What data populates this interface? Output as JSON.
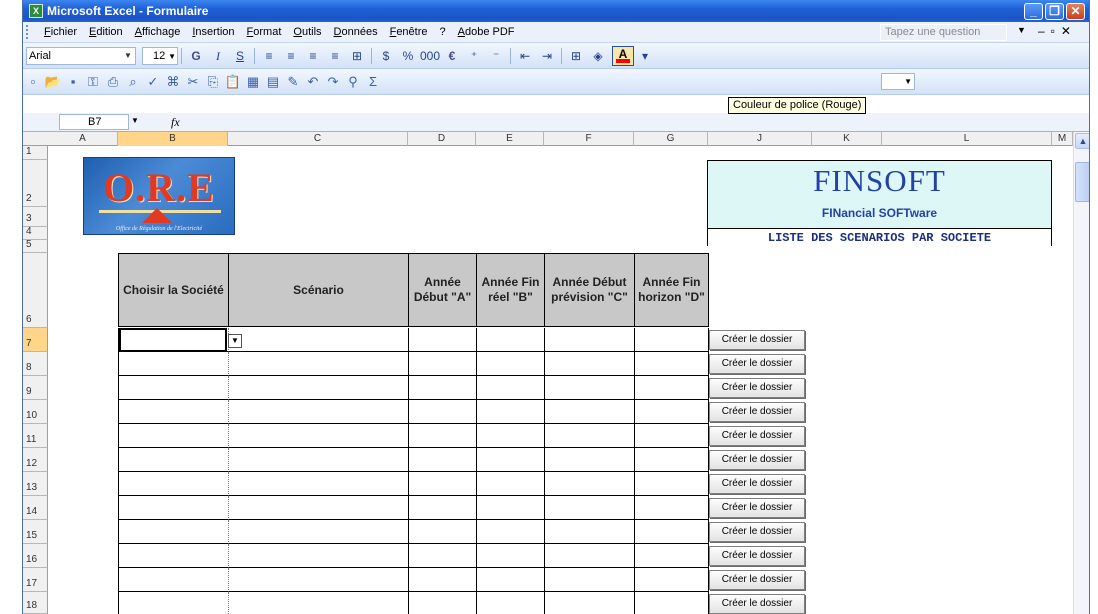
{
  "window": {
    "title": "Microsoft Excel - Formulaire",
    "app_icon": "excel-icon",
    "controls": [
      "minimize-icon",
      "maximize-icon",
      "close-icon"
    ]
  },
  "menu": {
    "items": [
      "Fichier",
      "Edition",
      "Affichage",
      "Insertion",
      "Format",
      "Outils",
      "Données",
      "Fenêtre",
      "?",
      "Adobe PDF"
    ],
    "question_placeholder": "Tapez une question"
  },
  "format_toolbar": {
    "font": "Arial",
    "size": "12",
    "bold": "G",
    "italic": "I",
    "underline": "S",
    "font_color_letter": "A",
    "font_color_hex": "#ff0000"
  },
  "tooltip": "Couleur de police (Rouge)",
  "formula_bar": {
    "name_box": "B7",
    "fx": "fx",
    "content": ""
  },
  "grid": {
    "columns": [
      "A",
      "B",
      "C",
      "D",
      "E",
      "F",
      "G",
      "J",
      "K",
      "L",
      "M"
    ],
    "selected_column": "B",
    "rows": [
      "1",
      "2",
      "3",
      "4",
      "5",
      "6",
      "7",
      "8",
      "9",
      "10",
      "11",
      "12",
      "13",
      "14",
      "15",
      "16",
      "17",
      "18"
    ],
    "selected_row": "7"
  },
  "logo": {
    "text": "O.R.E",
    "subtitle": "Office de Régulation de l'Electricité"
  },
  "brand": {
    "title": "FINSOFT",
    "subtitle": "FINancial SOFTware",
    "banner": "LISTE DES SCENARIOS PAR SOCIETE",
    "color": "#2242a8"
  },
  "table": {
    "headers": [
      "Choisir la Société",
      "Scénario",
      "Année Début \"A\"",
      "Année Fin réel \"B\"",
      "Année Début prévision \"C\"",
      "Année Fin horizon \"D\""
    ],
    "header_bg": "#c8c8c8",
    "rows": [
      [
        "",
        "",
        "",
        "",
        "",
        ""
      ],
      [
        "",
        "",
        "",
        "",
        "",
        ""
      ],
      [
        "",
        "",
        "",
        "",
        "",
        ""
      ],
      [
        "",
        "",
        "",
        "",
        "",
        ""
      ],
      [
        "",
        "",
        "",
        "",
        "",
        ""
      ],
      [
        "",
        "",
        "",
        "",
        "",
        ""
      ],
      [
        "",
        "",
        "",
        "",
        "",
        ""
      ],
      [
        "",
        "",
        "",
        "",
        "",
        ""
      ],
      [
        "",
        "",
        "",
        "",
        "",
        ""
      ],
      [
        "",
        "",
        "",
        "",
        "",
        ""
      ],
      [
        "",
        "",
        "",
        "",
        "",
        ""
      ],
      [
        "",
        "",
        "",
        "",
        "",
        ""
      ]
    ],
    "button_label": "Créer le dossier"
  }
}
